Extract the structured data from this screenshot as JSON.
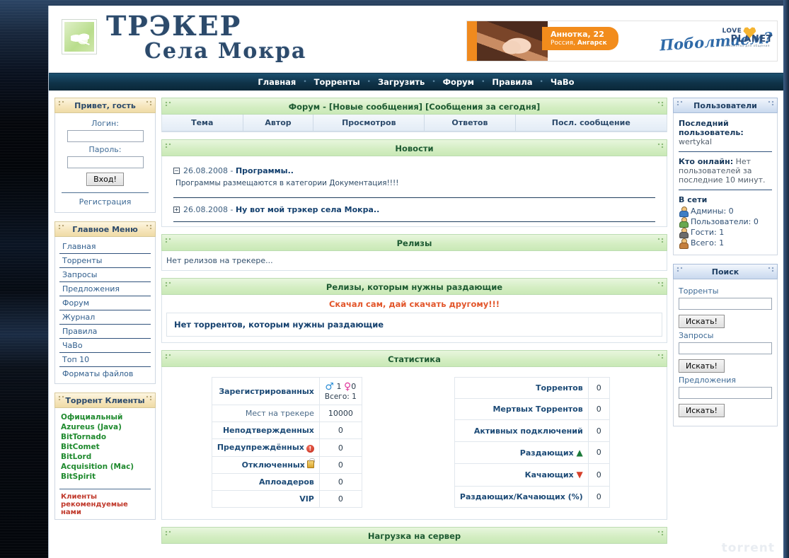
{
  "header": {
    "logo_line1": "ТРЭКЕР",
    "logo_line2": "Села Мокра",
    "logo_icon": "butterfly-leaf-icon",
    "banner": {
      "name_age": "Аннотка, 22",
      "location_prefix": "Россия, ",
      "location_city": "Ангарск",
      "slogan": "Поболтаем?",
      "brand_love": "LOVE",
      "brand_planet": "PLANET",
      "brand_sub": "Знакомства для общения"
    }
  },
  "nav": {
    "items": [
      {
        "label": "Главная"
      },
      {
        "label": "Торренты"
      },
      {
        "label": "Загрузить"
      },
      {
        "label": "Форум"
      },
      {
        "label": "Правила"
      },
      {
        "label": "ЧаВо"
      }
    ],
    "separator": "•"
  },
  "sidebar_left": {
    "login_panel": {
      "title": "Привет, гость",
      "login_label": "Логин:",
      "login_value": "",
      "password_label": "Пароль:",
      "password_value": "",
      "submit_label": "Вход!",
      "register_label": "Регистрация"
    },
    "menu_panel": {
      "title": "Главное Меню",
      "items": [
        {
          "label": "Главная"
        },
        {
          "label": "Торренты"
        },
        {
          "label": "Запросы"
        },
        {
          "label": "Предложения"
        },
        {
          "label": "Форум"
        },
        {
          "label": "Журнал"
        },
        {
          "label": "Правила"
        },
        {
          "label": "ЧаВо"
        },
        {
          "label": "Топ 10"
        },
        {
          "label": "Форматы файлов"
        }
      ]
    },
    "clients_panel": {
      "title": "Торрент Клиенты",
      "items": [
        {
          "label": "Официальный"
        },
        {
          "label": "Azureus (Java)"
        },
        {
          "label": "BitTornado"
        },
        {
          "label": "BitComet"
        },
        {
          "label": "BitLord"
        },
        {
          "label": "Acquisition (Mac)"
        },
        {
          "label": "BitSpirit"
        }
      ],
      "note": "Клиенты рекомендуемые нами"
    }
  },
  "main": {
    "forum": {
      "title": "Форум - [Новые сообщения] [Сообщения за сегодня]",
      "columns": [
        "Тема",
        "Автор",
        "Просмотров",
        "Ответов",
        "Посл. сообщение"
      ]
    },
    "news": {
      "title": "Новости",
      "items": [
        {
          "toggle": "−",
          "date": "26.08.2008 - ",
          "title": "Программы..",
          "body": "Программы размещаются в категории Документация!!!!"
        },
        {
          "toggle": "+",
          "date": "26.08.2008 - ",
          "title": "Ну вот мой трэкер села Мокра..",
          "body": ""
        }
      ]
    },
    "releases": {
      "title": "Релизы",
      "empty_text": "Нет релизов на трекере..."
    },
    "need_seeders": {
      "title": "Релизы, которым нужны раздающие",
      "motto": "Скачал сам, дай скачать другому!!!",
      "empty_text": "Нет торрентов, которым нужны раздающие"
    },
    "statistics": {
      "title": "Статистика",
      "left_rows": [
        {
          "label": "Зарегистрированных",
          "male_icon": "♂",
          "male": "1",
          "female_icon": "♀",
          "female": "0",
          "total": "Всего: 1",
          "type": "gender"
        },
        {
          "label": "Мест на трекере",
          "value": "10000",
          "type": "plain"
        },
        {
          "label": "Неподтвержденных",
          "value": "0",
          "type": "plain"
        },
        {
          "label": "Предупреждённых",
          "value": "0",
          "type": "warn"
        },
        {
          "label": "Отключенных",
          "value": "0",
          "type": "lock"
        },
        {
          "label": "Аплоадеров",
          "value": "0",
          "type": "gold"
        },
        {
          "label": "VIP",
          "value": "0",
          "type": "vip"
        }
      ],
      "right_rows": [
        {
          "label": "Торрентов",
          "value": "0"
        },
        {
          "label": "Мертвых Торрентов",
          "value": "0"
        },
        {
          "label": "Активных подключений",
          "value": "0"
        },
        {
          "label": "Раздающих",
          "value": "0",
          "marker": "▲",
          "marker_dir": "up"
        },
        {
          "label": "Качающих",
          "value": "0",
          "marker": "▼",
          "marker_dir": "down"
        },
        {
          "label": "Раздающих/Качающих (%)",
          "value": "0"
        }
      ]
    },
    "server_load": {
      "title": "Нагрузка на сервер"
    }
  },
  "sidebar_right": {
    "users_panel": {
      "title": "Пользователи",
      "last_user_label": "Последний пользователь:",
      "last_user_value": "wertykal",
      "online_label": "Кто онлайн:",
      "online_value": "Нет пользователей за последние 10 минут.",
      "network_title": "В сети",
      "rows": [
        {
          "label": "Админы: 0",
          "icon": "admin-user-icon"
        },
        {
          "label": "Пользователи: 0",
          "icon": "member-user-icon"
        },
        {
          "label": "Гости: 1",
          "icon": "guest-user-icon"
        },
        {
          "label": "Всего: 1",
          "icon": "total-users-icon"
        }
      ]
    },
    "search_panel": {
      "title": "Поиск",
      "fields": [
        {
          "label": "Торренты",
          "value": "",
          "button": "Искать!"
        },
        {
          "label": "Запросы",
          "value": "",
          "button": "Искать!"
        },
        {
          "label": "Предложения",
          "value": "",
          "button": "Искать!"
        }
      ]
    }
  },
  "watermark": "torrent"
}
